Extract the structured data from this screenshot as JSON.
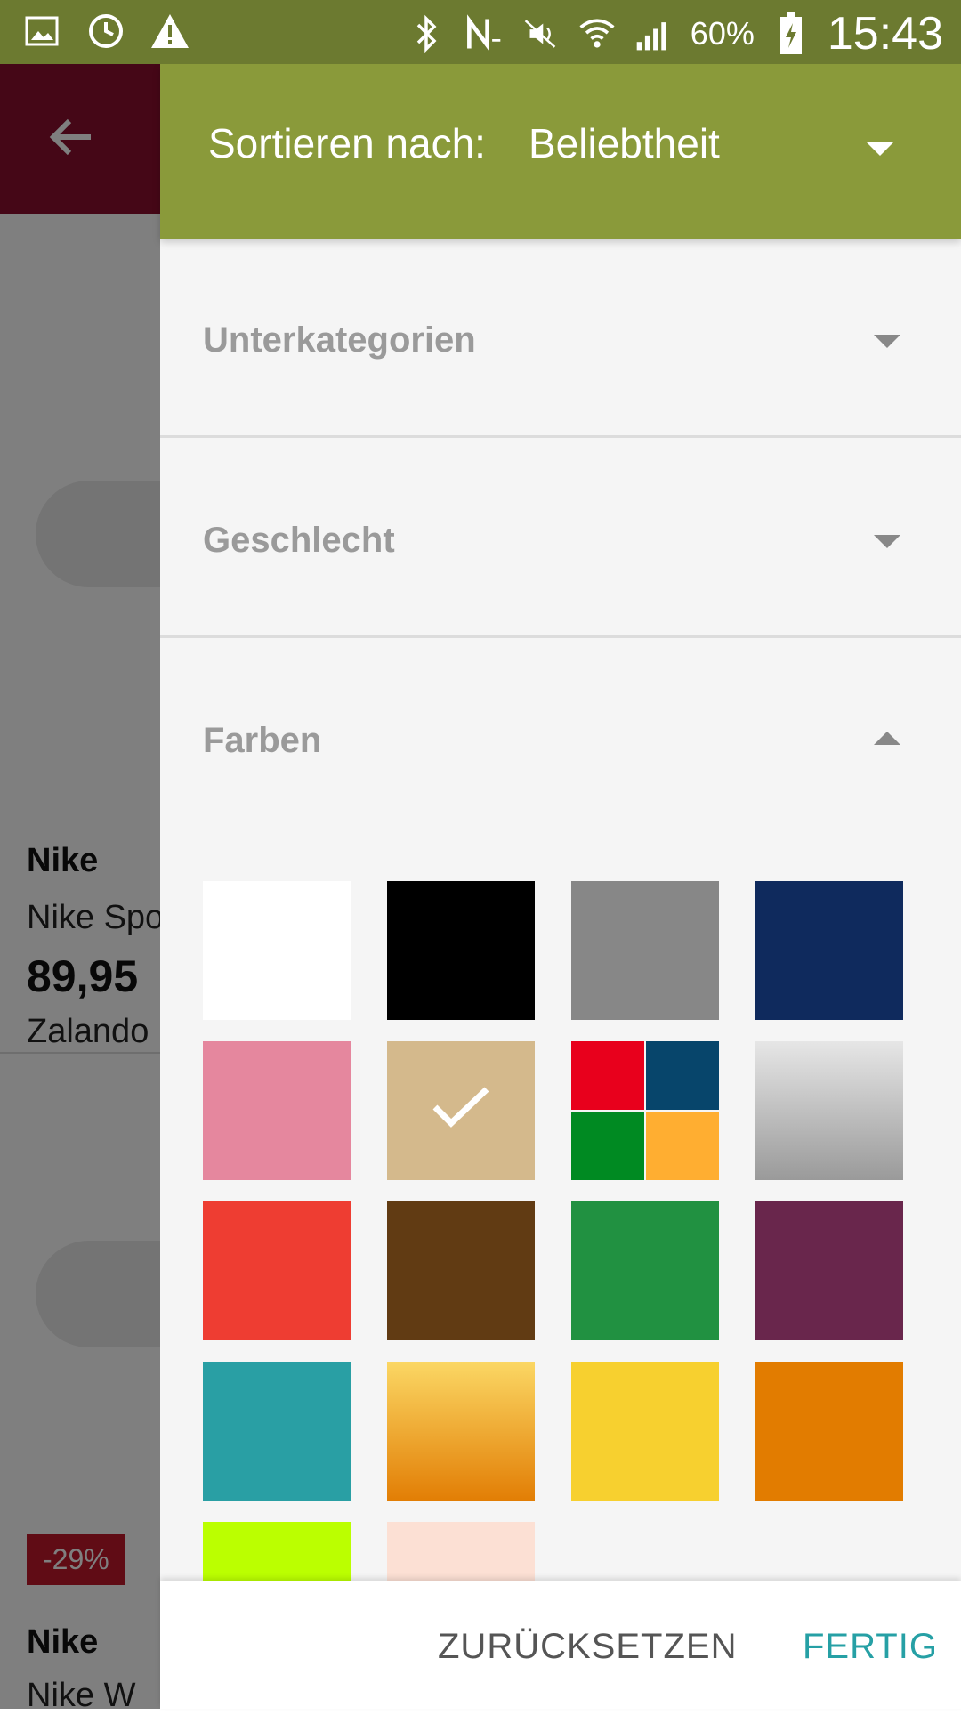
{
  "status_bar": {
    "icons_left": [
      "gallery-icon",
      "sync-icon",
      "warning-icon"
    ],
    "icons_right": [
      "bluetooth-icon",
      "nfc-icon",
      "mute-icon",
      "wifi-icon",
      "signal-icon"
    ],
    "battery_percent": "60%",
    "time": "15:43"
  },
  "background": {
    "products": [
      {
        "brand": "Nike",
        "name": "Nike Spo",
        "price": "89,95",
        "shop": "Zalando"
      },
      {
        "badge": "-29%",
        "brand": "Nike",
        "name": "Nike W"
      }
    ]
  },
  "drawer": {
    "sort_label": "Sortieren nach:",
    "sort_value": "Beliebtheit",
    "sections": [
      {
        "title": "Unterkategorien",
        "expanded": false
      },
      {
        "title": "Geschlecht",
        "expanded": false
      },
      {
        "title": "Farben",
        "expanded": true
      }
    ],
    "colors": [
      {
        "name": "white",
        "hex": "#ffffff",
        "selected": false
      },
      {
        "name": "black",
        "hex": "#000000",
        "selected": false
      },
      {
        "name": "grey",
        "hex": "#878787",
        "selected": false
      },
      {
        "name": "navy",
        "hex": "#0f2a5d",
        "selected": false
      },
      {
        "name": "pink",
        "hex": "#e5879e",
        "selected": false
      },
      {
        "name": "beige",
        "hex": "#d4b98c",
        "selected": true
      },
      {
        "name": "multicolor",
        "hex": "multi",
        "selected": false,
        "parts": [
          "#e8001c",
          "#07456b",
          "#008a22",
          "#ffae31"
        ]
      },
      {
        "name": "silver",
        "hex": "linear-gradient(#e6e6e6,#9a9a9a)",
        "selected": false
      },
      {
        "name": "red",
        "hex": "#ee3d32",
        "selected": false
      },
      {
        "name": "brown",
        "hex": "#613b13",
        "selected": false
      },
      {
        "name": "green",
        "hex": "#219141",
        "selected": false
      },
      {
        "name": "purple",
        "hex": "#69264c",
        "selected": false
      },
      {
        "name": "turquoise",
        "hex": "#299fa4",
        "selected": false
      },
      {
        "name": "gold",
        "hex": "linear-gradient(#fbd764,#e27e05)",
        "selected": false
      },
      {
        "name": "yellow",
        "hex": "#f7d02f",
        "selected": false
      },
      {
        "name": "orange",
        "hex": "#e27c00",
        "selected": false
      },
      {
        "name": "lime",
        "hex": "#bbff00",
        "selected": false
      },
      {
        "name": "peach",
        "hex": "#fce0d4",
        "selected": false
      }
    ]
  },
  "footer": {
    "reset_label": "ZURÜCKSETZEN",
    "done_label": "FERTIG"
  },
  "theme": {
    "header_green": "#8a9a3a",
    "statusbar_green": "#6c7a30",
    "appbar_red": "#8b0f2e",
    "accent_teal": "#26a0a5"
  }
}
